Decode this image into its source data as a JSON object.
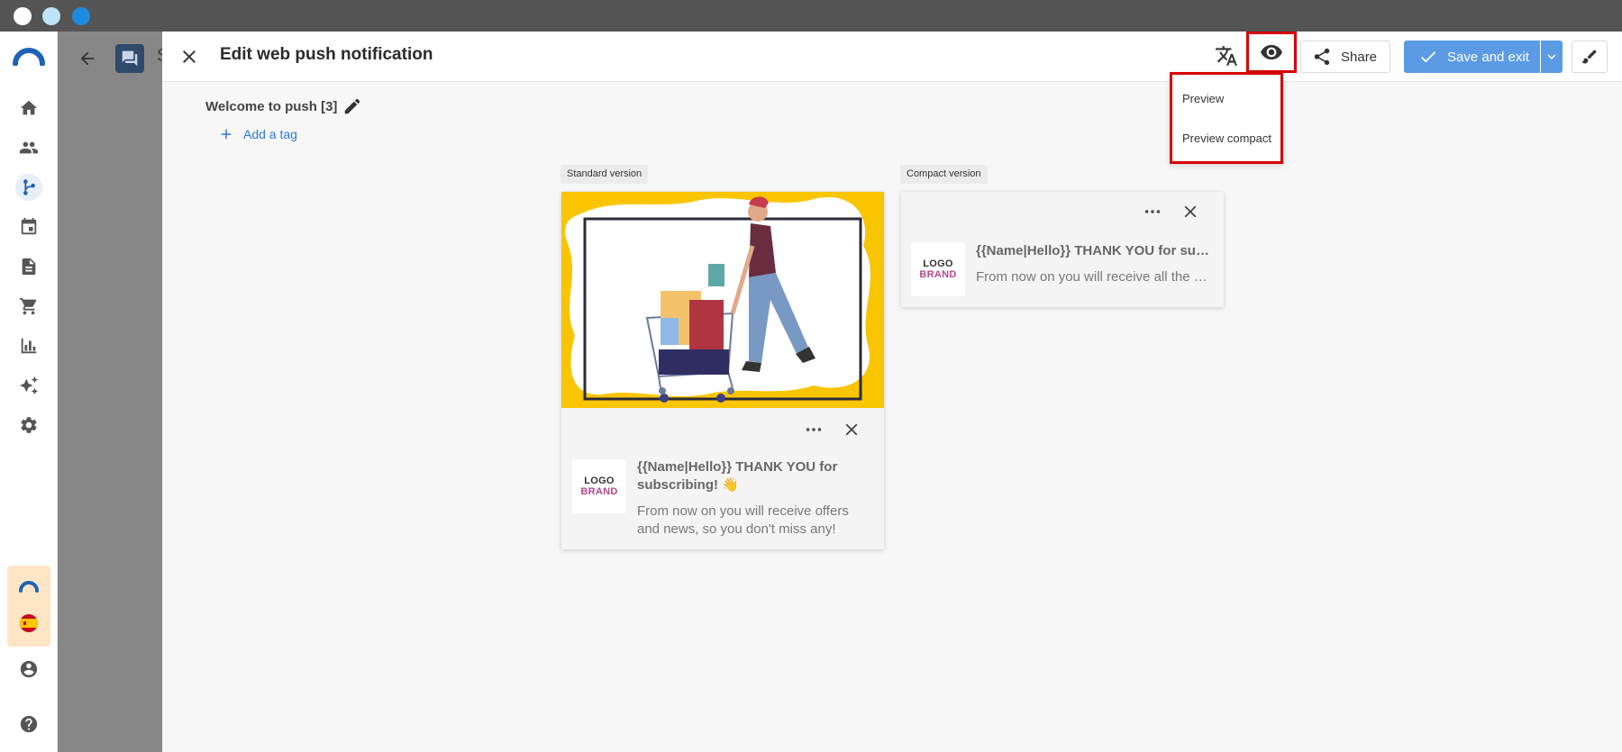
{
  "window": {
    "traffic_lights": [
      "close",
      "minimize",
      "maximize"
    ]
  },
  "background_page": {
    "title_initial": "S"
  },
  "left_nav": {
    "items": [
      {
        "icon": "home-icon"
      },
      {
        "icon": "people-icon"
      },
      {
        "icon": "flow-icon",
        "active": true
      },
      {
        "icon": "calendar-icon"
      },
      {
        "icon": "document-icon"
      },
      {
        "icon": "cart-icon"
      },
      {
        "icon": "chart-icon"
      },
      {
        "icon": "sparkle-icon"
      },
      {
        "icon": "gear-icon"
      }
    ],
    "bottom": [
      "user-icon",
      "help-icon"
    ]
  },
  "header": {
    "title": "Edit web push notification",
    "share_label": "Share",
    "save_label": "Save and exit"
  },
  "preview_menu": {
    "items": [
      "Preview",
      "Preview compact"
    ]
  },
  "campaign": {
    "name": "Welcome to push [3]",
    "add_tag_label": "Add a tag"
  },
  "standard": {
    "label": "Standard version",
    "title": "{{Name|Hello}} THANK YOU for subscribing! 👋",
    "body": "From now on you will receive offers and news, so you don't miss any!"
  },
  "compact": {
    "label": "Compact version",
    "title": "{{Name|Hello}} THANK YOU for subscribing! 👋",
    "body": "From now on you will receive all the offers and news, so you don't miss any!"
  },
  "logo": {
    "line1": "LOGO",
    "line2": "BRAND"
  },
  "colors": {
    "accent": "#5b9be5",
    "highlight": "#d60000",
    "link": "#2b78d8",
    "image_bg": "#f9c400"
  }
}
